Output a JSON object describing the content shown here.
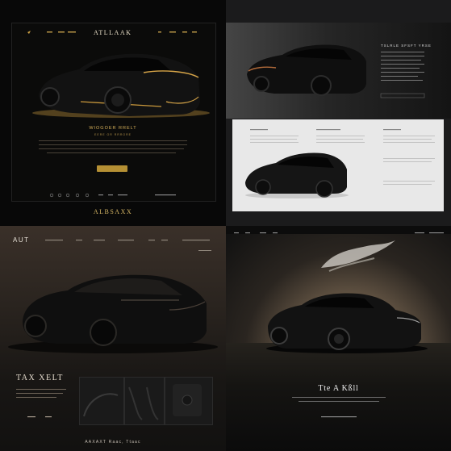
{
  "panel1": {
    "brand": "ATLLAAK",
    "subtitle": "WIOGOER RRELT",
    "tagline": "EERE OR RRRORE",
    "footer_brand": "ALBSAXX",
    "accent": "#d4a646"
  },
  "panel2": {
    "header_title": "TSLRLE SFSFT YRSE"
  },
  "panel3": {
    "logo": "AUT",
    "title": "TAX XELT",
    "footer": "AAXAXT Raac, Ttaac"
  },
  "panel4": {
    "title": "Tte A Kßll"
  }
}
